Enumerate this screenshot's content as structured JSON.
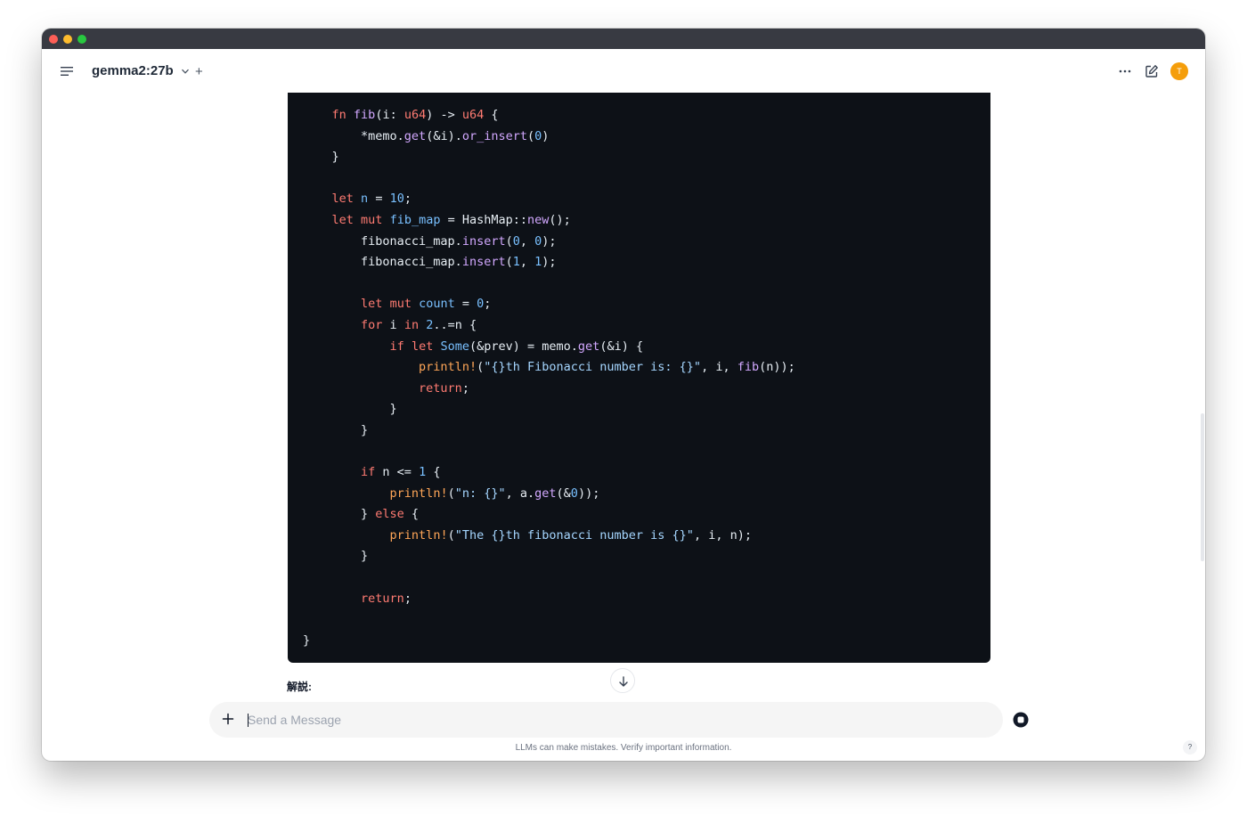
{
  "header": {
    "model_name": "gemma2:27b",
    "new_chat_label": "+",
    "avatar_initial": "T"
  },
  "code": {
    "lines": [
      [
        {
          "t": "    "
        },
        {
          "t": "fn",
          "c": "kw"
        },
        {
          "t": " "
        },
        {
          "t": "fib",
          "c": "fn"
        },
        {
          "t": "(i: "
        },
        {
          "t": "u64",
          "c": "type"
        },
        {
          "t": ") -> "
        },
        {
          "t": "u64",
          "c": "type"
        },
        {
          "t": " {"
        }
      ],
      [
        {
          "t": "        *memo."
        },
        {
          "t": "get",
          "c": "fn"
        },
        {
          "t": "(&i)."
        },
        {
          "t": "or_insert",
          "c": "fn"
        },
        {
          "t": "("
        },
        {
          "t": "0",
          "c": "num"
        },
        {
          "t": ")"
        }
      ],
      [
        {
          "t": "    }"
        }
      ],
      [
        {
          "t": ""
        }
      ],
      [
        {
          "t": "    "
        },
        {
          "t": "let",
          "c": "kw"
        },
        {
          "t": " "
        },
        {
          "t": "n",
          "c": "var"
        },
        {
          "t": " = "
        },
        {
          "t": "10",
          "c": "num"
        },
        {
          "t": ";"
        }
      ],
      [
        {
          "t": "    "
        },
        {
          "t": "let",
          "c": "kw"
        },
        {
          "t": " "
        },
        {
          "t": "mut",
          "c": "kw"
        },
        {
          "t": " "
        },
        {
          "t": "fib_map",
          "c": "var"
        },
        {
          "t": " = HashMap::"
        },
        {
          "t": "new",
          "c": "fn"
        },
        {
          "t": "();"
        }
      ],
      [
        {
          "t": "        fibonacci_map."
        },
        {
          "t": "insert",
          "c": "fn"
        },
        {
          "t": "("
        },
        {
          "t": "0",
          "c": "num"
        },
        {
          "t": ", "
        },
        {
          "t": "0",
          "c": "num"
        },
        {
          "t": ");"
        }
      ],
      [
        {
          "t": "        fibonacci_map."
        },
        {
          "t": "insert",
          "c": "fn"
        },
        {
          "t": "("
        },
        {
          "t": "1",
          "c": "num"
        },
        {
          "t": ", "
        },
        {
          "t": "1",
          "c": "num"
        },
        {
          "t": ");"
        }
      ],
      [
        {
          "t": ""
        }
      ],
      [
        {
          "t": "        "
        },
        {
          "t": "let",
          "c": "kw"
        },
        {
          "t": " "
        },
        {
          "t": "mut",
          "c": "kw"
        },
        {
          "t": " "
        },
        {
          "t": "count",
          "c": "var"
        },
        {
          "t": " = "
        },
        {
          "t": "0",
          "c": "num"
        },
        {
          "t": ";"
        }
      ],
      [
        {
          "t": "        "
        },
        {
          "t": "for",
          "c": "kw"
        },
        {
          "t": " i "
        },
        {
          "t": "in",
          "c": "kw"
        },
        {
          "t": " "
        },
        {
          "t": "2",
          "c": "num"
        },
        {
          "t": "..=n {"
        }
      ],
      [
        {
          "t": "            "
        },
        {
          "t": "if",
          "c": "kw"
        },
        {
          "t": " "
        },
        {
          "t": "let",
          "c": "kw"
        },
        {
          "t": " "
        },
        {
          "t": "Some",
          "c": "var"
        },
        {
          "t": "(&prev) = memo."
        },
        {
          "t": "get",
          "c": "fn"
        },
        {
          "t": "(&i) {"
        }
      ],
      [
        {
          "t": "                "
        },
        {
          "t": "println!",
          "c": "macro"
        },
        {
          "t": "("
        },
        {
          "t": "\"{}th Fibonacci number is: {}\"",
          "c": "str"
        },
        {
          "t": ", i, "
        },
        {
          "t": "fib",
          "c": "fn"
        },
        {
          "t": "(n));"
        }
      ],
      [
        {
          "t": "                "
        },
        {
          "t": "return",
          "c": "kw"
        },
        {
          "t": ";"
        }
      ],
      [
        {
          "t": "            }"
        }
      ],
      [
        {
          "t": "        }"
        }
      ],
      [
        {
          "t": ""
        }
      ],
      [
        {
          "t": "        "
        },
        {
          "t": "if",
          "c": "kw"
        },
        {
          "t": " n <= "
        },
        {
          "t": "1",
          "c": "num"
        },
        {
          "t": " {"
        }
      ],
      [
        {
          "t": "            "
        },
        {
          "t": "println!",
          "c": "macro"
        },
        {
          "t": "("
        },
        {
          "t": "\"n: {}\"",
          "c": "str"
        },
        {
          "t": ", a."
        },
        {
          "t": "get",
          "c": "fn"
        },
        {
          "t": "(&"
        },
        {
          "t": "0",
          "c": "num"
        },
        {
          "t": "));"
        }
      ],
      [
        {
          "t": "        } "
        },
        {
          "t": "else",
          "c": "kw"
        },
        {
          "t": " {"
        }
      ],
      [
        {
          "t": "            "
        },
        {
          "t": "println!",
          "c": "macro"
        },
        {
          "t": "("
        },
        {
          "t": "\"The {}th fibonacci number is {}\"",
          "c": "str"
        },
        {
          "t": ", i, n);"
        }
      ],
      [
        {
          "t": "        }"
        }
      ],
      [
        {
          "t": ""
        }
      ],
      [
        {
          "t": "        "
        },
        {
          "t": "return",
          "c": "kw"
        },
        {
          "t": ";"
        }
      ],
      [
        {
          "t": ""
        }
      ],
      [
        {
          "t": "}"
        }
      ]
    ]
  },
  "response": {
    "explanation_label": "解説:"
  },
  "composer": {
    "placeholder": "Send a Message",
    "value": ""
  },
  "footer": {
    "disclaimer": "LLMs can make mistakes. Verify important information.",
    "help_label": "?"
  },
  "colors": {
    "titlebar": "#383a42",
    "code_background": "#0d1117",
    "avatar": "#f59e0b",
    "keyword": "#ff7b72",
    "function": "#d2a8ff",
    "variable": "#79c0ff",
    "string": "#a5d6ff",
    "macro": "#ffa657"
  },
  "icons": {
    "menu": "menu-icon",
    "model_dropdown": "chevron-down-icon",
    "more": "more-horizontal-icon",
    "new_chat": "edit-icon",
    "scroll_down": "arrow-down-icon",
    "attach": "plus-icon",
    "stop": "stop-icon"
  }
}
